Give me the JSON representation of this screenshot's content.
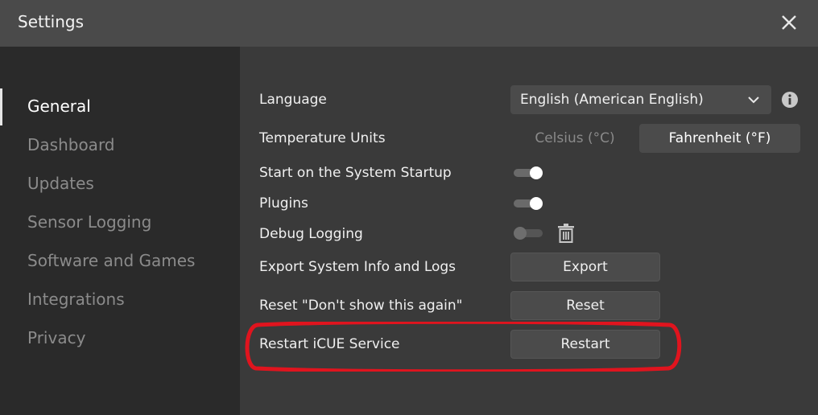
{
  "window": {
    "title": "Settings"
  },
  "sidebar": {
    "items": [
      {
        "label": "General",
        "active": true
      },
      {
        "label": "Dashboard"
      },
      {
        "label": "Updates"
      },
      {
        "label": "Sensor Logging"
      },
      {
        "label": "Software and Games"
      },
      {
        "label": "Integrations"
      },
      {
        "label": "Privacy"
      }
    ]
  },
  "general": {
    "language": {
      "label": "Language",
      "value": "English (American English)"
    },
    "temperature": {
      "label": "Temperature Units",
      "options": [
        "Celsius (°C)",
        "Fahrenheit (°F)"
      ],
      "selected": "Fahrenheit (°F)"
    },
    "startup": {
      "label": "Start on the System Startup",
      "enabled": true
    },
    "plugins": {
      "label": "Plugins",
      "enabled": true
    },
    "debug": {
      "label": "Debug Logging",
      "enabled": false
    },
    "export": {
      "label": "Export System Info and Logs",
      "button": "Export"
    },
    "reset": {
      "label": "Reset \"Don't show this again\"",
      "button": "Reset"
    },
    "restart": {
      "label": "Restart iCUE Service",
      "button": "Restart"
    }
  },
  "colors": {
    "titlebar": "#4a4a4a",
    "sidebar": "#2a2a2a",
    "content": "#3a3a3a",
    "button": "#4b4b4b",
    "highlight": "#e0141e"
  },
  "icons": [
    "close-icon",
    "chevron-down-icon",
    "info-icon",
    "trash-icon"
  ]
}
